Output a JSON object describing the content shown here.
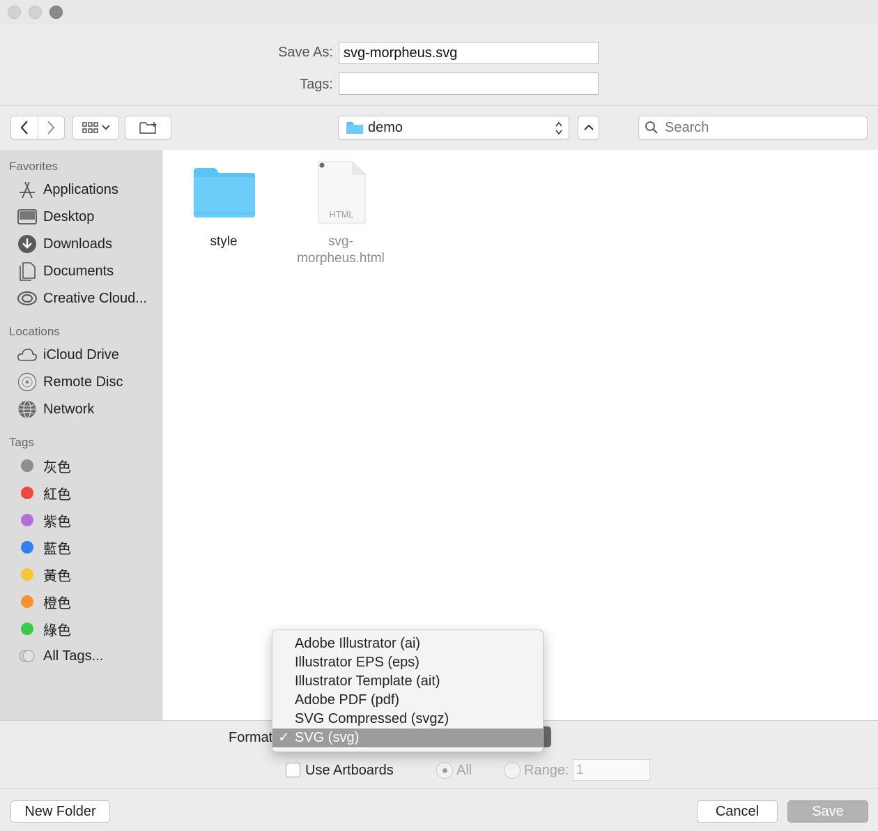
{
  "dialog": {
    "save_as_label": "Save As:",
    "save_as_value": "svg-morpheus.svg",
    "tags_label": "Tags:",
    "tags_value": ""
  },
  "toolbar": {
    "location": "demo",
    "search_placeholder": "Search"
  },
  "sidebar": {
    "favorites_header": "Favorites",
    "favorites": [
      {
        "label": "Applications",
        "icon": "applications-icon"
      },
      {
        "label": "Desktop",
        "icon": "desktop-icon"
      },
      {
        "label": "Downloads",
        "icon": "downloads-icon"
      },
      {
        "label": "Documents",
        "icon": "documents-icon"
      },
      {
        "label": "Creative Cloud...",
        "icon": "creative-cloud-icon"
      }
    ],
    "locations_header": "Locations",
    "locations": [
      {
        "label": "iCloud Drive",
        "icon": "icloud-icon"
      },
      {
        "label": "Remote Disc",
        "icon": "disc-icon"
      },
      {
        "label": "Network",
        "icon": "network-icon"
      }
    ],
    "tags_header": "Tags",
    "tags": [
      {
        "label": "灰色",
        "color": "#8e8e8e"
      },
      {
        "label": "紅色",
        "color": "#f0483f"
      },
      {
        "label": "紫色",
        "color": "#b16fd8"
      },
      {
        "label": "藍色",
        "color": "#2f7ff0"
      },
      {
        "label": "黃色",
        "color": "#f6c932"
      },
      {
        "label": "橙色",
        "color": "#f7922f"
      },
      {
        "label": "綠色",
        "color": "#3cc94a"
      },
      {
        "label": "All Tags...",
        "color": "#d0d0d0"
      }
    ]
  },
  "files": [
    {
      "name": "style",
      "type": "folder"
    },
    {
      "name_line1": "svg-",
      "name_line2": "morpheus.html",
      "type_label": "HTML"
    }
  ],
  "format": {
    "label": "Format",
    "options": [
      "Adobe Illustrator (ai)",
      "Illustrator EPS (eps)",
      "Illustrator Template (ait)",
      "Adobe PDF (pdf)",
      "SVG Compressed (svgz)",
      "SVG (svg)"
    ],
    "selected": "SVG (svg)"
  },
  "options": {
    "use_artboards_label": "Use Artboards",
    "all_label": "All",
    "range_label": "Range:",
    "range_value": "1"
  },
  "buttons": {
    "new_folder": "New Folder",
    "cancel": "Cancel",
    "save": "Save"
  },
  "colors": {
    "folder_blue": "#5cc3f5",
    "selection_gray": "#9c9c9c"
  }
}
